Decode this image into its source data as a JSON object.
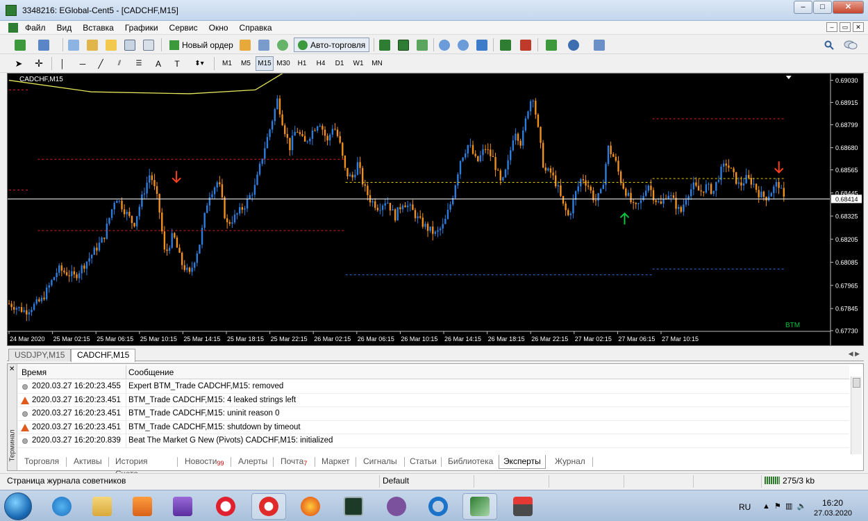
{
  "window": {
    "title": "3348216: EGlobal-Cent5 - [CADCHF,M15]",
    "controls": [
      "–",
      "□",
      "✕"
    ]
  },
  "menu": {
    "items": [
      "Файл",
      "Вид",
      "Вставка",
      "Графики",
      "Сервис",
      "Окно",
      "Справка"
    ],
    "mdi_controls": [
      "–",
      "▭",
      "✕"
    ]
  },
  "toolbar": {
    "new_order_label": "Новый ордер",
    "autotrading_label": "Авто-торговля",
    "timeframes": [
      "M1",
      "M5",
      "M15",
      "M30",
      "H1",
      "H4",
      "D1",
      "W1",
      "MN"
    ],
    "active_timeframe": "M15"
  },
  "chart": {
    "symbol_label": "CADCHF,M15",
    "indicator_label": "BTM",
    "current_price": "0.68414",
    "colors": {
      "background": "#000000",
      "bull": "#2e7ddc",
      "bear": "#f0901e",
      "ma": "#e6e65a",
      "price_line": "#ffffff",
      "red_level": "#e02020",
      "yellow_level": "#e6c800",
      "blue_level": "#2e6fd8",
      "signal_down": "#ff4020",
      "signal_up": "#10c040"
    }
  },
  "chart_data": {
    "type": "candlestick",
    "symbol": "CADCHF",
    "timeframe": "M15",
    "ylim": [
      0.6773,
      0.6905
    ],
    "y_ticks": [
      "0.69030",
      "0.68915",
      "0.68799",
      "0.68680",
      "0.68565",
      "0.68445",
      "0.68325",
      "0.68205",
      "0.68085",
      "0.67965",
      "0.67845",
      "0.67730"
    ],
    "x_ticks": [
      "24 Mar 2020",
      "25 Mar 02:15",
      "25 Mar 06:15",
      "25 Mar 10:15",
      "25 Mar 14:15",
      "25 Mar 18:15",
      "25 Mar 22:15",
      "26 Mar 02:15",
      "26 Mar 06:15",
      "26 Mar 10:15",
      "26 Mar 14:15",
      "26 Mar 18:15",
      "26 Mar 22:15",
      "27 Mar 02:15",
      "27 Mar 06:15",
      "27 Mar 10:15"
    ],
    "current_price": 0.68414,
    "close_path": [
      [
        0.0,
        0.6787
      ],
      [
        0.02,
        0.6783
      ],
      [
        0.04,
        0.6789
      ],
      [
        0.06,
        0.6805
      ],
      [
        0.08,
        0.6801
      ],
      [
        0.1,
        0.6812
      ],
      [
        0.115,
        0.6821
      ],
      [
        0.13,
        0.6843
      ],
      [
        0.14,
        0.6836
      ],
      [
        0.152,
        0.6828
      ],
      [
        0.162,
        0.6842
      ],
      [
        0.172,
        0.6855
      ],
      [
        0.182,
        0.6839
      ],
      [
        0.19,
        0.6812
      ],
      [
        0.2,
        0.6823
      ],
      [
        0.21,
        0.6808
      ],
      [
        0.22,
        0.6802
      ],
      [
        0.232,
        0.6818
      ],
      [
        0.243,
        0.6843
      ],
      [
        0.255,
        0.6851
      ],
      [
        0.265,
        0.6828
      ],
      [
        0.275,
        0.6832
      ],
      [
        0.287,
        0.6838
      ],
      [
        0.3,
        0.6848
      ],
      [
        0.31,
        0.6866
      ],
      [
        0.318,
        0.6878
      ],
      [
        0.327,
        0.6893
      ],
      [
        0.334,
        0.688
      ],
      [
        0.342,
        0.6868
      ],
      [
        0.35,
        0.6878
      ],
      [
        0.36,
        0.687
      ],
      [
        0.37,
        0.6877
      ],
      [
        0.378,
        0.6882
      ],
      [
        0.388,
        0.6871
      ],
      [
        0.395,
        0.688
      ],
      [
        0.402,
        0.6872
      ],
      [
        0.41,
        0.6855
      ],
      [
        0.418,
        0.6852
      ],
      [
        0.425,
        0.686
      ],
      [
        0.432,
        0.6848
      ],
      [
        0.44,
        0.6841
      ],
      [
        0.45,
        0.6837
      ],
      [
        0.46,
        0.6841
      ],
      [
        0.47,
        0.6832
      ],
      [
        0.48,
        0.684
      ],
      [
        0.49,
        0.6836
      ],
      [
        0.5,
        0.683
      ],
      [
        0.51,
        0.6826
      ],
      [
        0.52,
        0.6823
      ],
      [
        0.53,
        0.6828
      ],
      [
        0.54,
        0.6842
      ],
      [
        0.55,
        0.6862
      ],
      [
        0.56,
        0.687
      ],
      [
        0.57,
        0.686
      ],
      [
        0.58,
        0.6868
      ],
      [
        0.59,
        0.6862
      ],
      [
        0.6,
        0.6848
      ],
      [
        0.608,
        0.686
      ],
      [
        0.616,
        0.6878
      ],
      [
        0.624,
        0.687
      ],
      [
        0.632,
        0.6888
      ],
      [
        0.638,
        0.6896
      ],
      [
        0.645,
        0.6876
      ],
      [
        0.652,
        0.6856
      ],
      [
        0.66,
        0.6855
      ],
      [
        0.668,
        0.6848
      ],
      [
        0.675,
        0.6838
      ],
      [
        0.682,
        0.6832
      ],
      [
        0.69,
        0.6844
      ],
      [
        0.698,
        0.6853
      ],
      [
        0.706,
        0.6848
      ],
      [
        0.714,
        0.684
      ],
      [
        0.722,
        0.6845
      ],
      [
        0.73,
        0.6868
      ],
      [
        0.738,
        0.6862
      ],
      [
        0.746,
        0.685
      ],
      [
        0.754,
        0.6843
      ],
      [
        0.762,
        0.6836
      ],
      [
        0.77,
        0.684
      ],
      [
        0.778,
        0.685
      ],
      [
        0.786,
        0.6842
      ],
      [
        0.794,
        0.6838
      ],
      [
        0.802,
        0.6845
      ],
      [
        0.81,
        0.684
      ],
      [
        0.818,
        0.6834
      ],
      [
        0.826,
        0.6844
      ],
      [
        0.834,
        0.6848
      ],
      [
        0.842,
        0.6845
      ],
      [
        0.85,
        0.6848
      ],
      [
        0.858,
        0.6845
      ],
      [
        0.866,
        0.6855
      ],
      [
        0.874,
        0.686
      ],
      [
        0.882,
        0.6854
      ],
      [
        0.89,
        0.6848
      ],
      [
        0.898,
        0.6852
      ],
      [
        0.906,
        0.685
      ],
      [
        0.914,
        0.6844
      ],
      [
        0.922,
        0.6842
      ],
      [
        0.93,
        0.6846
      ],
      [
        0.937,
        0.685
      ],
      [
        0.944,
        0.6841
      ]
    ],
    "moving_average": [
      [
        0.0,
        0.6903
      ],
      [
        0.1,
        0.6897
      ],
      [
        0.22,
        0.6896
      ],
      [
        0.3,
        0.6898
      ],
      [
        0.335,
        0.6907
      ],
      [
        0.365,
        0.6912
      ],
      [
        0.4,
        0.6914
      ]
    ],
    "levels": [
      {
        "color": "red",
        "price": 0.6862,
        "x_from": 0.035,
        "x_to": 0.41
      },
      {
        "color": "red",
        "price": 0.6825,
        "x_from": 0.035,
        "x_to": 0.41
      },
      {
        "color": "red",
        "price": 0.6898,
        "x_from": 0.0,
        "x_to": 0.025
      },
      {
        "color": "red",
        "price": 0.6846,
        "x_from": 0.0,
        "x_to": 0.025
      },
      {
        "color": "yellow",
        "price": 0.685,
        "x_from": 0.41,
        "x_to": 0.784
      },
      {
        "color": "blue",
        "price": 0.6802,
        "x_from": 0.41,
        "x_to": 0.784
      },
      {
        "color": "red",
        "price": 0.6883,
        "x_from": 0.784,
        "x_to": 0.946
      },
      {
        "color": "yellow",
        "price": 0.6852,
        "x_from": 0.784,
        "x_to": 0.946
      },
      {
        "color": "blue",
        "price": 0.6805,
        "x_from": 0.784,
        "x_to": 0.946
      }
    ],
    "signals": [
      {
        "direction": "down",
        "x": 0.204,
        "price": 0.6853
      },
      {
        "direction": "up",
        "x": 0.75,
        "price": 0.6831
      },
      {
        "direction": "down",
        "x": 0.938,
        "price": 0.6858
      }
    ]
  },
  "chart_tabs": [
    {
      "label": "USDJPY,M15",
      "active": false
    },
    {
      "label": "CADCHF,M15",
      "active": true
    }
  ],
  "terminal": {
    "side_label": "Терминал",
    "close_icon": "✕",
    "headers": {
      "time": "Время",
      "message": "Сообщение"
    },
    "rows": [
      {
        "level": "info",
        "time": "2020.03.27 16:20:23.455",
        "message": "Expert BTM_Trade CADCHF,M15: removed"
      },
      {
        "level": "warning",
        "time": "2020.03.27 16:20:23.451",
        "message": "BTM_Trade CADCHF,M15: 4 leaked strings left"
      },
      {
        "level": "info",
        "time": "2020.03.27 16:20:23.451",
        "message": "BTM_Trade CADCHF,M15: uninit reason 0"
      },
      {
        "level": "warning",
        "time": "2020.03.27 16:20:23.451",
        "message": "BTM_Trade CADCHF,M15: shutdown by timeout"
      },
      {
        "level": "info",
        "time": "2020.03.27 16:20:20.839",
        "message": "Beat The Market G New (Pivots) CADCHF,M15: initialized"
      }
    ],
    "tabs": [
      {
        "label": "Торговля"
      },
      {
        "label": "Активы"
      },
      {
        "label": "История Счета"
      },
      {
        "label": "Новости",
        "badge": "99"
      },
      {
        "label": "Алерты"
      },
      {
        "label": "Почта",
        "badge": "7"
      },
      {
        "label": "Маркет"
      },
      {
        "label": "Сигналы"
      },
      {
        "label": "Статьи"
      },
      {
        "label": "Библиотека"
      },
      {
        "label": "Эксперты",
        "active": true
      },
      {
        "label": "Журнал"
      }
    ]
  },
  "statusbar": {
    "hint": "Страница журнала советников",
    "profile": "Default",
    "traffic": "275/3 kb"
  },
  "taskbar": {
    "language": "RU",
    "time": "16:20",
    "date": "27.03.2020"
  }
}
